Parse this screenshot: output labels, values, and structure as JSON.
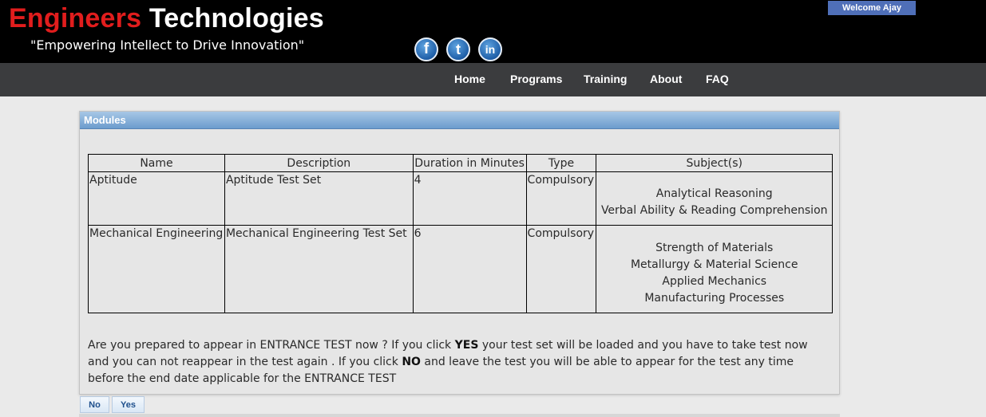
{
  "header": {
    "brand_part1": "Engineers",
    "brand_part2": "Technologies",
    "tagline": "\"Empowering Intellect to Drive Innovation\"",
    "welcome": "Welcome Ajay",
    "social": [
      {
        "icon": "facebook-icon",
        "glyph": "f"
      },
      {
        "icon": "twitter-icon",
        "glyph": "t"
      },
      {
        "icon": "linkedin-icon",
        "glyph": "in"
      }
    ]
  },
  "nav": {
    "items": [
      "Home",
      "Programs",
      "Training",
      "About",
      "FAQ"
    ]
  },
  "panel": {
    "title": "Modules",
    "columns": [
      "Name",
      "Description",
      "Duration in Minutes",
      "Type",
      "Subject(s)"
    ],
    "rows": [
      {
        "name": "Aptitude",
        "description": "Aptitude Test Set",
        "duration": "4",
        "type": "Compulsory",
        "subjects": [
          "Analytical Reasoning",
          "Verbal Ability & Reading Comprehension"
        ]
      },
      {
        "name": "Mechanical Engineering",
        "description": "Mechanical Engineering Test Set",
        "duration": "6",
        "type": "Compulsory",
        "subjects": [
          "Strength of Materials",
          "Metallurgy & Material Science",
          "Applied Mechanics",
          "Manufacturing Processes"
        ]
      }
    ],
    "prompt": {
      "part1": "Are you prepared to appear in ENTRANCE TEST now ? If you click ",
      "yes_word": "YES",
      "part2": " your test set will be loaded and you have to take test now and you can not reappear in the test again . If you click ",
      "no_word": "NO",
      "part3": " and leave the test you will be able to appear for the test any time before the end date applicable for the ENTRANCE TEST"
    }
  },
  "buttons": {
    "no": "No",
    "yes": "Yes"
  },
  "colors": {
    "brand_red": "#e11d1d",
    "header_bg": "#000000",
    "nav_bg": "#3b3c3e",
    "panel_title_bg": "#6c9ccd",
    "welcome_bg": "#4f6fb8"
  }
}
